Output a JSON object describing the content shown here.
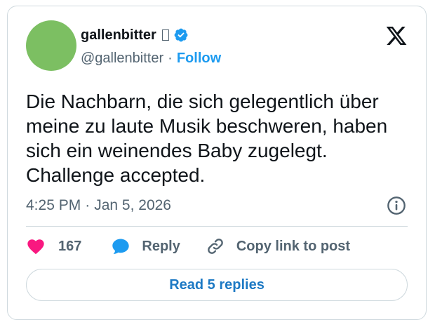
{
  "author": {
    "display_name": "gallenbitter",
    "handle": "@gallenbitter",
    "follow_label": "Follow"
  },
  "tweet": {
    "text_lines": [
      "Die Nachbarn, die sich gelegentlich über",
      "meine zu laute Musik beschweren, haben",
      "sich ein weinendes Baby zugelegt.",
      "Challenge accepted."
    ],
    "time": "4:25 PM",
    "date": "Jan 5, 2026"
  },
  "actions": {
    "like_count": "167",
    "reply_label": "Reply",
    "copy_link_label": "Copy link to post"
  },
  "replies_button_label": "Read 5 replies",
  "icons": {
    "brand": "x-logo-icon",
    "verified": "verified-badge-icon",
    "info": "info-icon",
    "like": "heart-icon",
    "reply": "speech-bubble-icon",
    "copy_link": "link-icon"
  },
  "colors": {
    "accent": "#1d9bf0",
    "like": "#f91880",
    "avatar": "#7cbf62",
    "muted_text": "#536471",
    "border": "#cfd9de"
  }
}
